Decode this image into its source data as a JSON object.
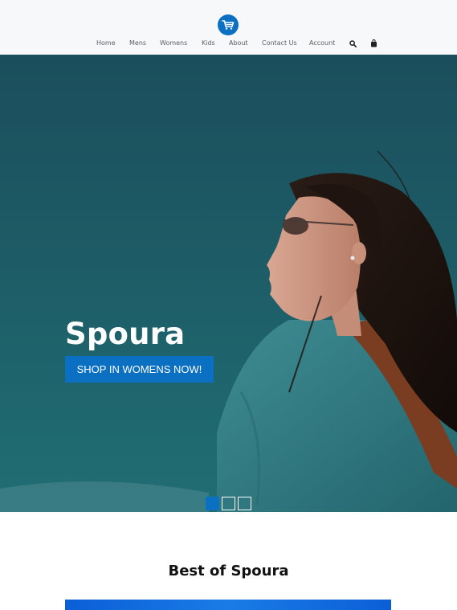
{
  "nav": {
    "items": [
      "Home",
      "Mens",
      "Womens",
      "Kids",
      "About",
      "Contact Us",
      "Account"
    ],
    "icons": [
      "search-icon",
      "shopping-bag-icon"
    ]
  },
  "logo": {
    "icon": "shopping-cart-icon",
    "color": "#0b6fc2"
  },
  "hero": {
    "title": "Spoura",
    "cta_label": "SHOP IN WOMENS NOW!",
    "slides": 3,
    "active_slide": 1
  },
  "section": {
    "title": "Best of Spoura"
  },
  "colors": {
    "accent": "#0b6fc2",
    "hero_bg": "#1d5c66",
    "header_bg": "#f7f8fa"
  }
}
